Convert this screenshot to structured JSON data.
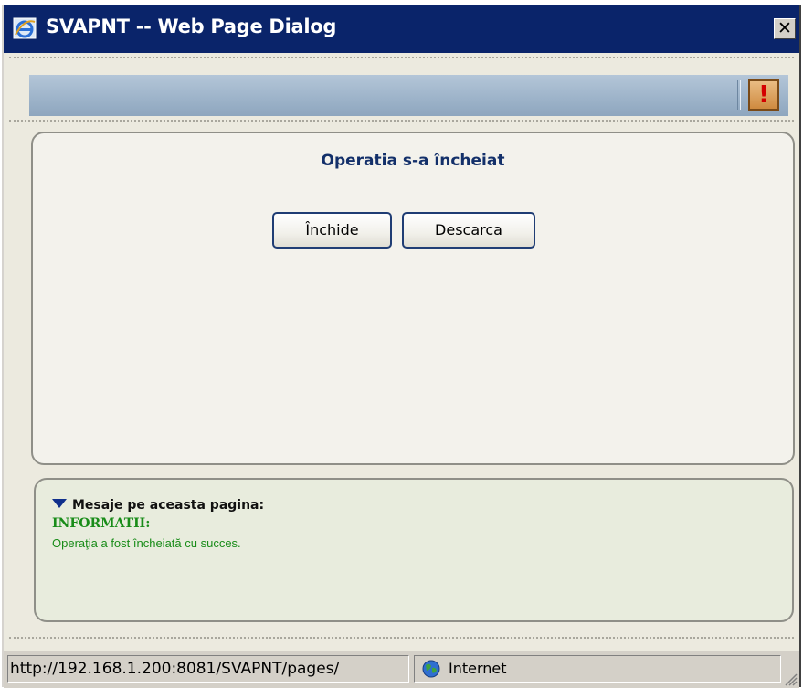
{
  "window": {
    "title": "SVAPNT -- Web Page Dialog",
    "close_glyph": "✕"
  },
  "toolbar": {
    "warning_glyph": "!"
  },
  "main": {
    "heading": "Operatia s-a încheiat",
    "buttons": {
      "close_label": "Închide",
      "download_label": "Descarca"
    }
  },
  "messages": {
    "header": "Mesaje pe aceasta pagina:",
    "type": "INFORMATII:",
    "text": "Operaţia a fost încheiată cu succes."
  },
  "statusbar": {
    "url": "http://192.168.1.200:8081/SVAPNT/pages/",
    "zone": "Internet"
  },
  "colors": {
    "titlebar": "#0a246a",
    "accent_blue": "#13306a",
    "success_green": "#198c19"
  },
  "icons": {
    "title": "ie-logo-icon",
    "warning": "exclamation-icon",
    "collapse": "triangle-down-icon",
    "zone": "globe-icon"
  }
}
